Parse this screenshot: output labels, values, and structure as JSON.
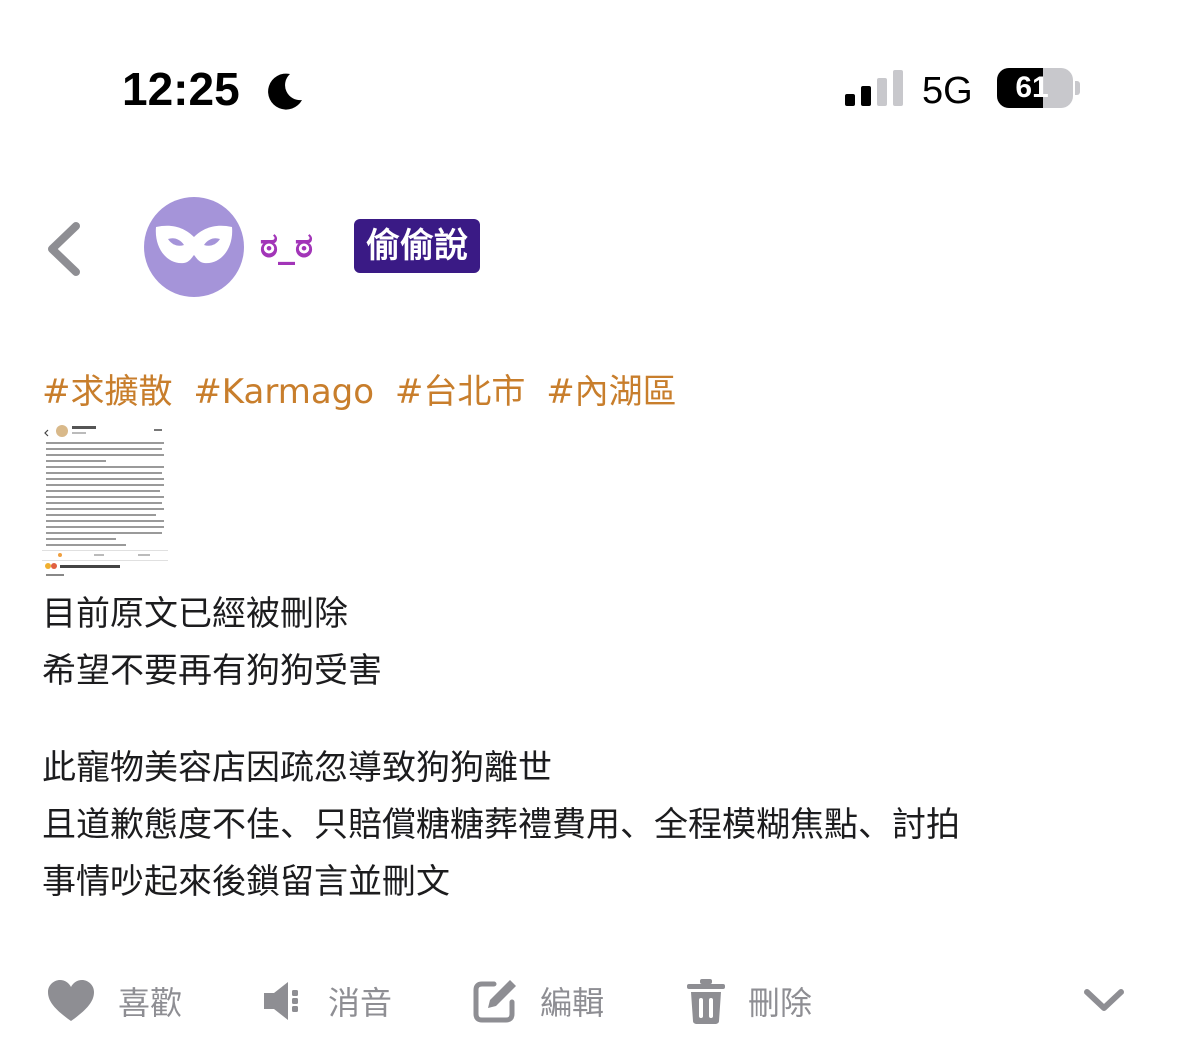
{
  "status_bar": {
    "time": "12:25",
    "network": "5G",
    "battery_percent": 61,
    "battery_text": "61"
  },
  "header": {
    "username": "ಠ_ಠ",
    "badge": "偷偷說"
  },
  "post": {
    "hashtags": [
      "#求擴散",
      "#Karmago",
      "#台北市",
      "#內湖區"
    ],
    "paragraphs": [
      [
        "目前原文已經被刪除",
        "希望不要再有狗狗受害"
      ],
      [
        "此寵物美容店因疏忽導致狗狗離世",
        "且道歉態度不佳、只賠償糖糖葬禮費用、全程模糊焦點、討拍",
        "事情吵起來後鎖留言並刪文"
      ]
    ]
  },
  "actions": {
    "like": "喜歡",
    "mute": "消音",
    "edit": "編輯",
    "delete": "刪除"
  },
  "colors": {
    "hashtag": "#c87e2c",
    "badge_bg": "#3a1a85",
    "avatar_bg": "#a594d9",
    "username": "#a235b8",
    "action_gray": "#8e8e93"
  }
}
